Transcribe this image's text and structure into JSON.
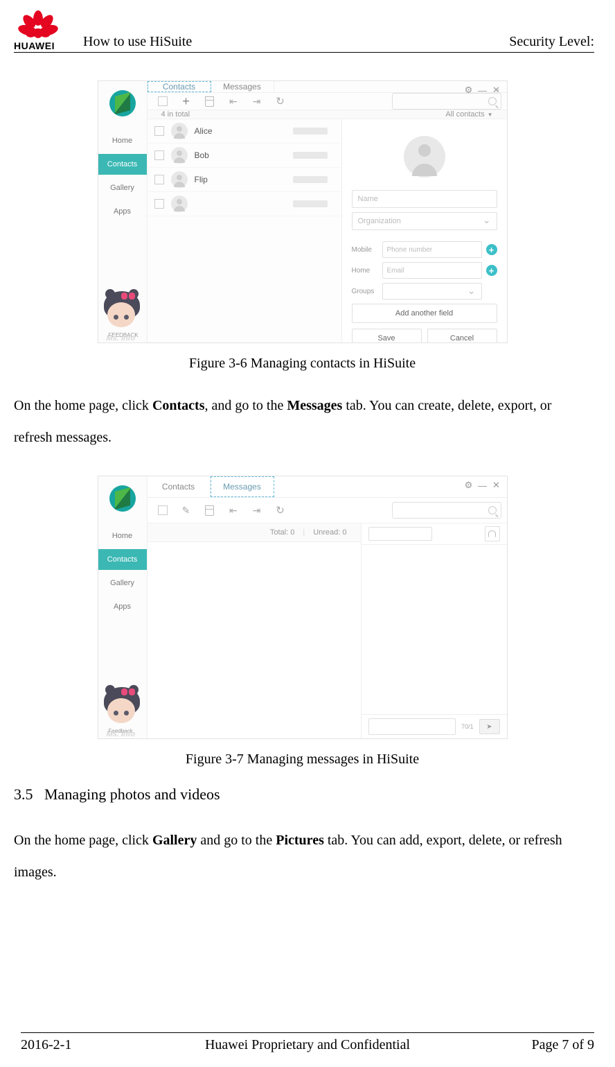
{
  "header": {
    "doc_title": "How to use HiSuite",
    "security_label": "Security Level:",
    "logo_text": "HUAWEI"
  },
  "footer": {
    "date": "2016-2-1",
    "center": "Huawei Proprietary and Confidential",
    "page": "Page 7 of 9"
  },
  "fig1": {
    "caption": "Figure 3-6 Managing contacts in HiSuite",
    "nav": {
      "home": "Home",
      "contacts": "Contacts",
      "gallery": "Gallery",
      "apps": "Apps"
    },
    "tabs": {
      "contacts": "Contacts",
      "messages": "Messages"
    },
    "subbar": {
      "total": "4 in total",
      "filter": "All contacts"
    },
    "contacts": [
      "Alice",
      "Bob",
      "Flip",
      ""
    ],
    "panel": {
      "name_ph": "Name",
      "org_ph": "Organization",
      "mobile": "Mobile",
      "home": "Home",
      "groups": "Groups",
      "phone_ph": "Phone number",
      "email_ph": "Email",
      "add_field": "Add another field",
      "save": "Save",
      "cancel": "Cancel"
    },
    "feedback": "FEEDBACK",
    "watermark": "Ms. Info"
  },
  "para1": {
    "t1": "On the home page, click ",
    "b1": "Contacts",
    "t2": ", and go to the ",
    "b2": "Messages",
    "t3": " tab. You can create, delete, export, or refresh messages."
  },
  "fig2": {
    "caption": "Figure 3-7 Managing messages in HiSuite",
    "nav": {
      "home": "Home",
      "contacts": "Contacts",
      "gallery": "Gallery",
      "apps": "Apps"
    },
    "tabs": {
      "contacts": "Contacts",
      "messages": "Messages"
    },
    "subbar": {
      "total": "Total: 0",
      "unread": "Unread: 0"
    },
    "compose_count": "70/1",
    "feedback": "Feedback",
    "watermark": "Ms. Info"
  },
  "section": {
    "num": "3.5",
    "title": "Managing photos and videos"
  },
  "para2": {
    "t1": "On the home page, click ",
    "b1": "Gallery",
    "t2": " and go to the ",
    "b2": "Pictures",
    "t3": " tab. You can add, export, delete, or refresh images."
  }
}
